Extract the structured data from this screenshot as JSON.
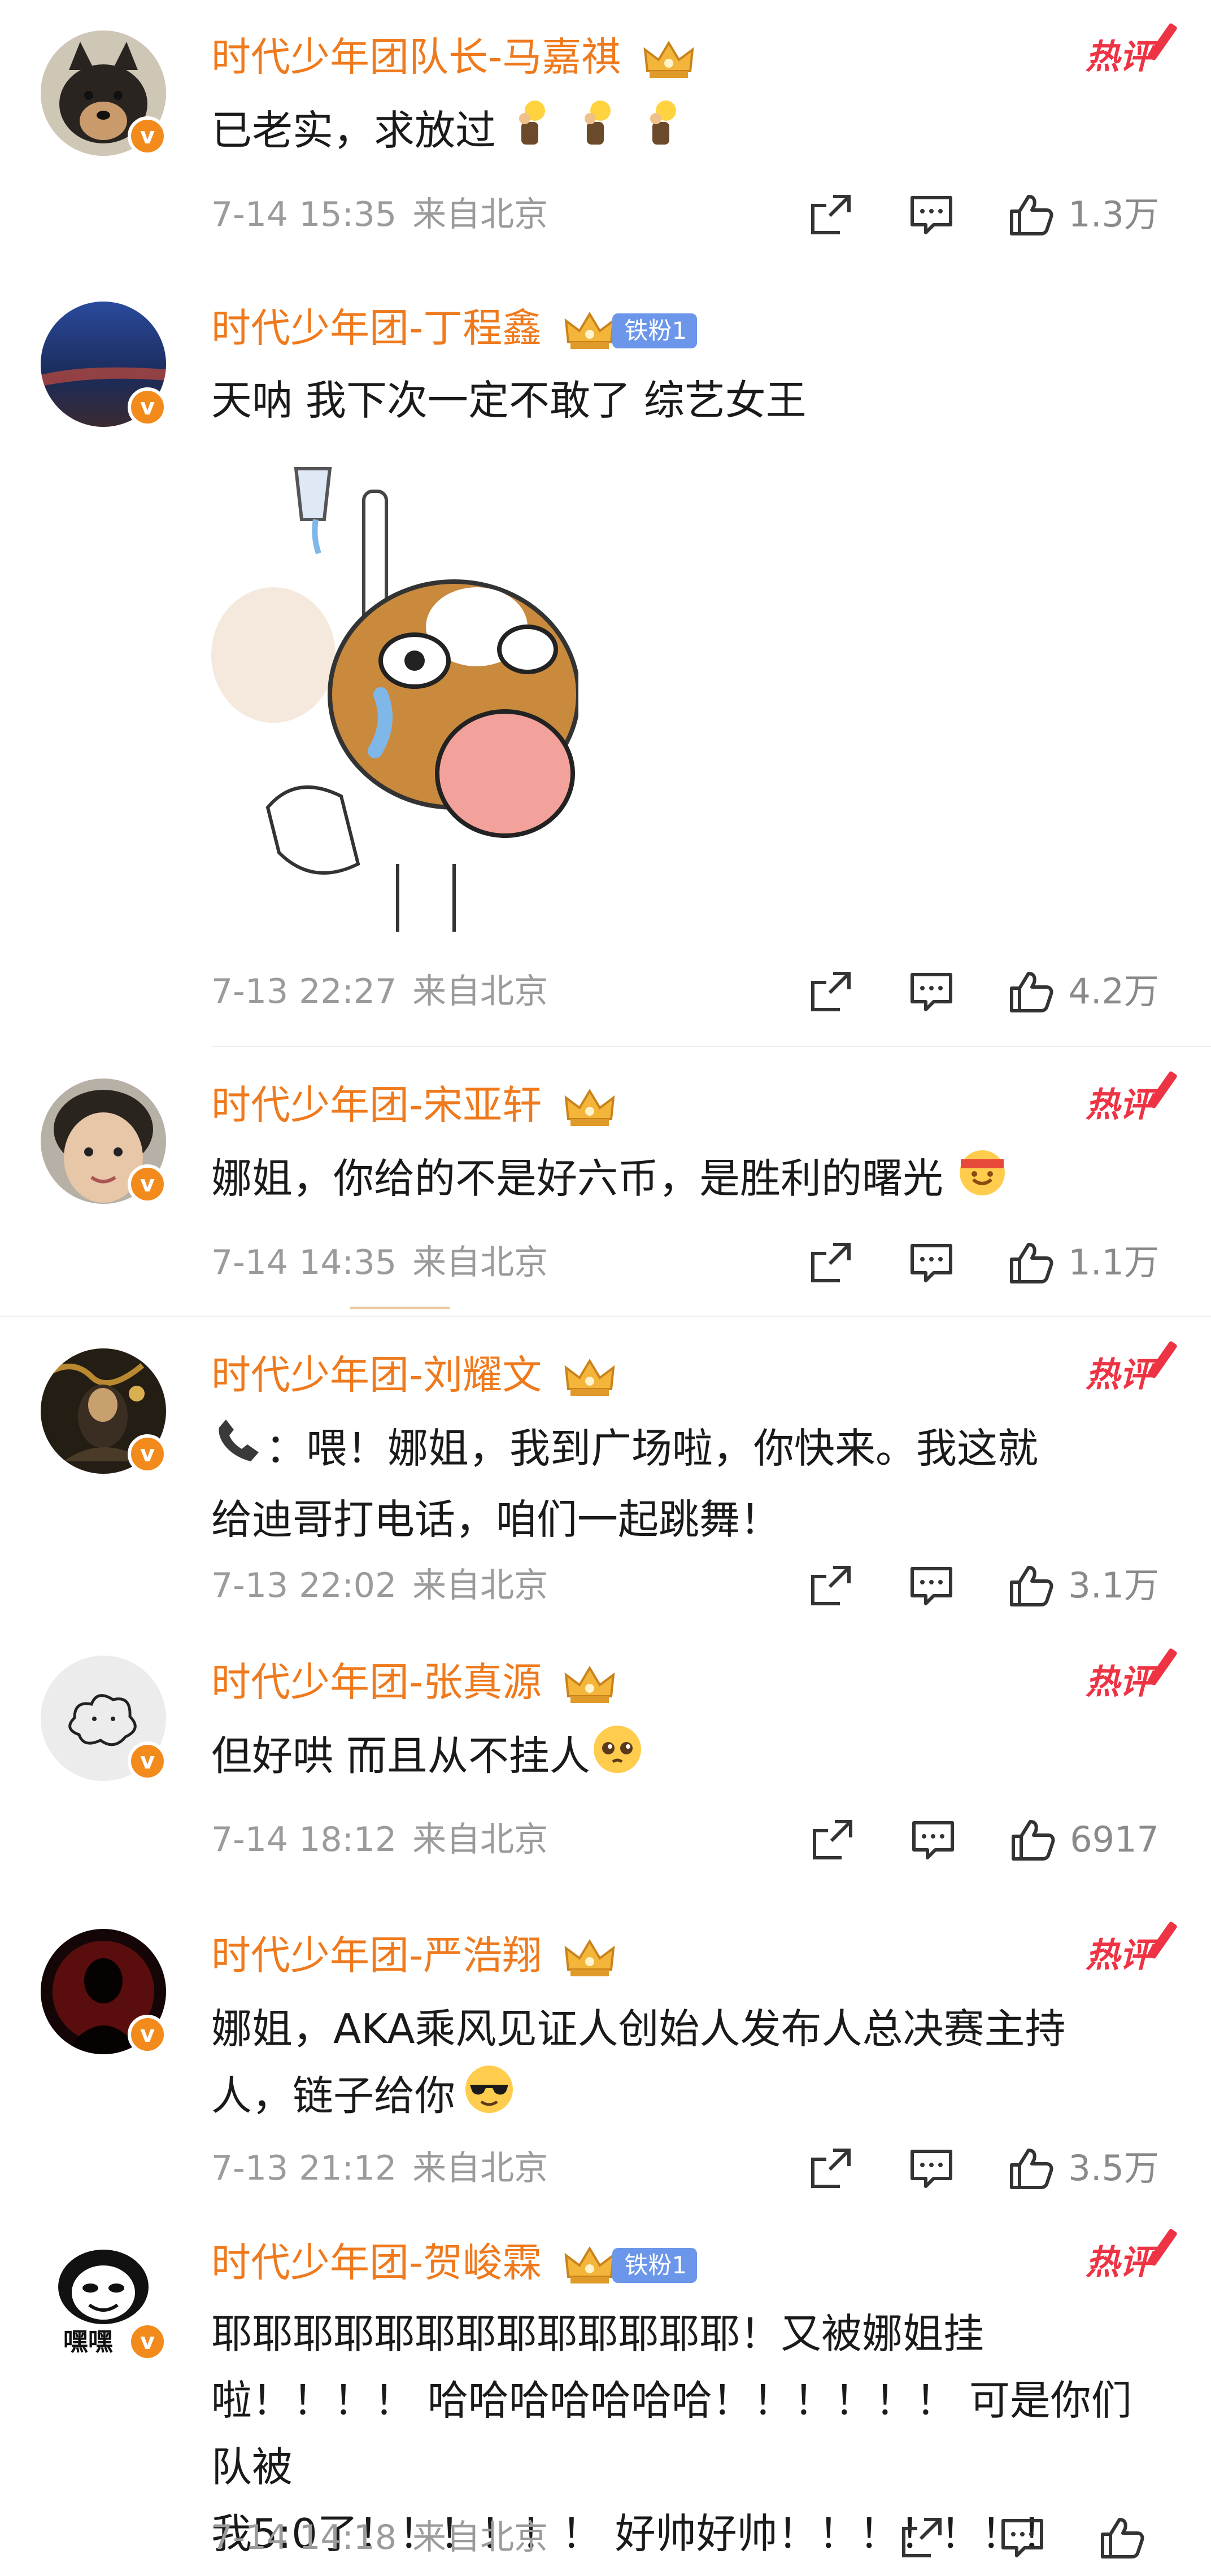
{
  "comments": [
    {
      "name": "时代少年团队长-马嘉祺",
      "text": "已老实，求放过",
      "hot": "热评",
      "time": "7-14 15:35",
      "location": "来自北京",
      "likes": "1.3万",
      "avatar": "shiba-dog",
      "emoji_trailing": "lightbulb-person-icon x3"
    },
    {
      "name": "时代少年团-丁程鑫",
      "fan_badge": "铁粉1",
      "text": "天呐 我下次一定不敢了 综艺女王",
      "time": "7-13 22:27",
      "location": "来自北京",
      "likes": "4.2万",
      "avatar": "night-sky",
      "sticker": "crying-dog-sticker"
    },
    {
      "name": "时代少年团-宋亚轩",
      "text": "娜姐，你给的不是好六币，是胜利的曙光",
      "hot": "热评",
      "time": "7-14 14:35",
      "location": "来自北京",
      "likes": "1.1万",
      "avatar": "boy-photo"
    },
    {
      "name": "时代少年团-刘耀文",
      "text": "：喂！娜姐，我到广场啦，你快来。我这就\n给迪哥打电话，咱们一起跳舞！",
      "hot": "热评",
      "time": "7-13 22:02",
      "location": "来自北京",
      "likes": "3.1万",
      "avatar": "dark-performance",
      "emoji_leading": "phone-icon"
    },
    {
      "name": "时代少年团-张真源",
      "text": "但好哄 而且从不挂人",
      "hot": "热评",
      "time": "7-14 18:12",
      "location": "来自北京",
      "likes": "6917",
      "avatar": "line-drawing"
    },
    {
      "name": "时代少年团-严浩翔",
      "text": "娜姐，AKA乘风见证人创始人发布人总决赛主持\n人，链子给你",
      "hot": "热评",
      "time": "7-13 21:12",
      "location": "来自北京",
      "likes": "3.5万",
      "avatar": "red-silhouette"
    },
    {
      "name": "时代少年团-贺峻霖",
      "fan_badge": "铁粉1",
      "text": "耶耶耶耶耶耶耶耶耶耶耶耶耶！又被娜姐挂\n啦！！！！ 哈哈哈哈哈哈哈！！！！！！ 可是你们队被\n我5:0了！！！！！！ 好帅好帅！！！！！！！",
      "hot": "热评",
      "time": "7-14 14:18",
      "location": "来自北京",
      "likes": "",
      "avatar": "panda-meme",
      "avatar_text": "嘿嘿"
    }
  ],
  "colors": {
    "name": "#ef7a1d",
    "hot": "#ee3344",
    "meta": "#9b9b9b",
    "text": "#1a1a1a",
    "verified": "#f28a1c",
    "fan_badge": "#6b96ea"
  }
}
